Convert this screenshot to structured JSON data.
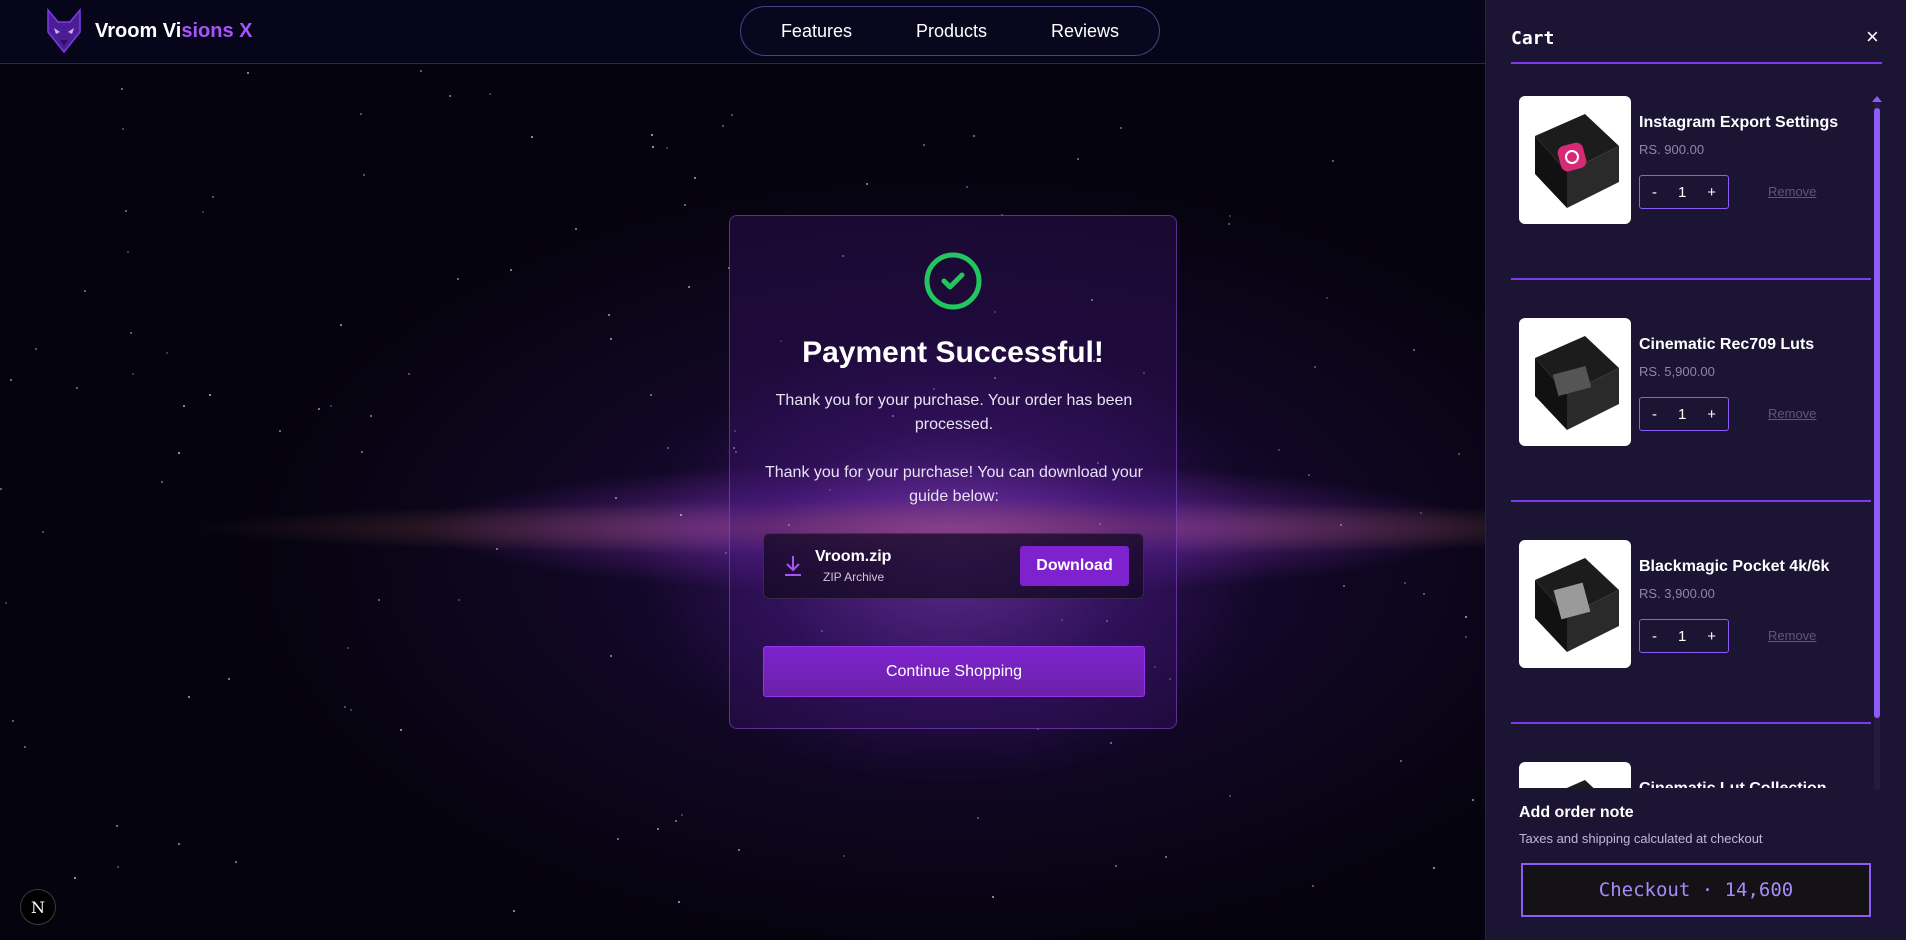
{
  "header": {
    "brand_part1": "Vroom Vi",
    "brand_part2": "sions X",
    "nav": [
      "Features",
      "Products",
      "Reviews"
    ]
  },
  "success": {
    "title": "Payment Successful!",
    "message1": "Thank you for your purchase. Your order has been processed.",
    "message2": "Thank you for your purchase! You can download your guide below:",
    "file_name": "Vroom.zip",
    "file_type": "ZIP Archive",
    "download_label": "Download",
    "continue_label": "Continue Shopping"
  },
  "cart": {
    "title": "Cart",
    "close": "×",
    "items": [
      {
        "name": "Instagram Export Settings",
        "price": "RS. 900.00",
        "qty": "1",
        "minus": "-",
        "plus": "+",
        "remove": "Remove"
      },
      {
        "name": "Cinematic Rec709 Luts",
        "price": "RS. 5,900.00",
        "qty": "1",
        "minus": "-",
        "plus": "+",
        "remove": "Remove"
      },
      {
        "name": "Blackmagic Pocket 4k/6k",
        "price": "RS. 3,900.00",
        "qty": "1",
        "minus": "-",
        "plus": "+",
        "remove": "Remove"
      },
      {
        "name": "Cinematic Lut Collection",
        "price": "",
        "qty": "",
        "minus": "",
        "plus": "",
        "remove": ""
      }
    ],
    "note_title": "Add order note",
    "tax_text": "Taxes and shipping calculated at checkout",
    "checkout_label": "Checkout · 14,600"
  },
  "badge": "N",
  "colors": {
    "accent": "#7e22ce",
    "success": "#22c55e",
    "brand_highlight": "#a855f7"
  }
}
